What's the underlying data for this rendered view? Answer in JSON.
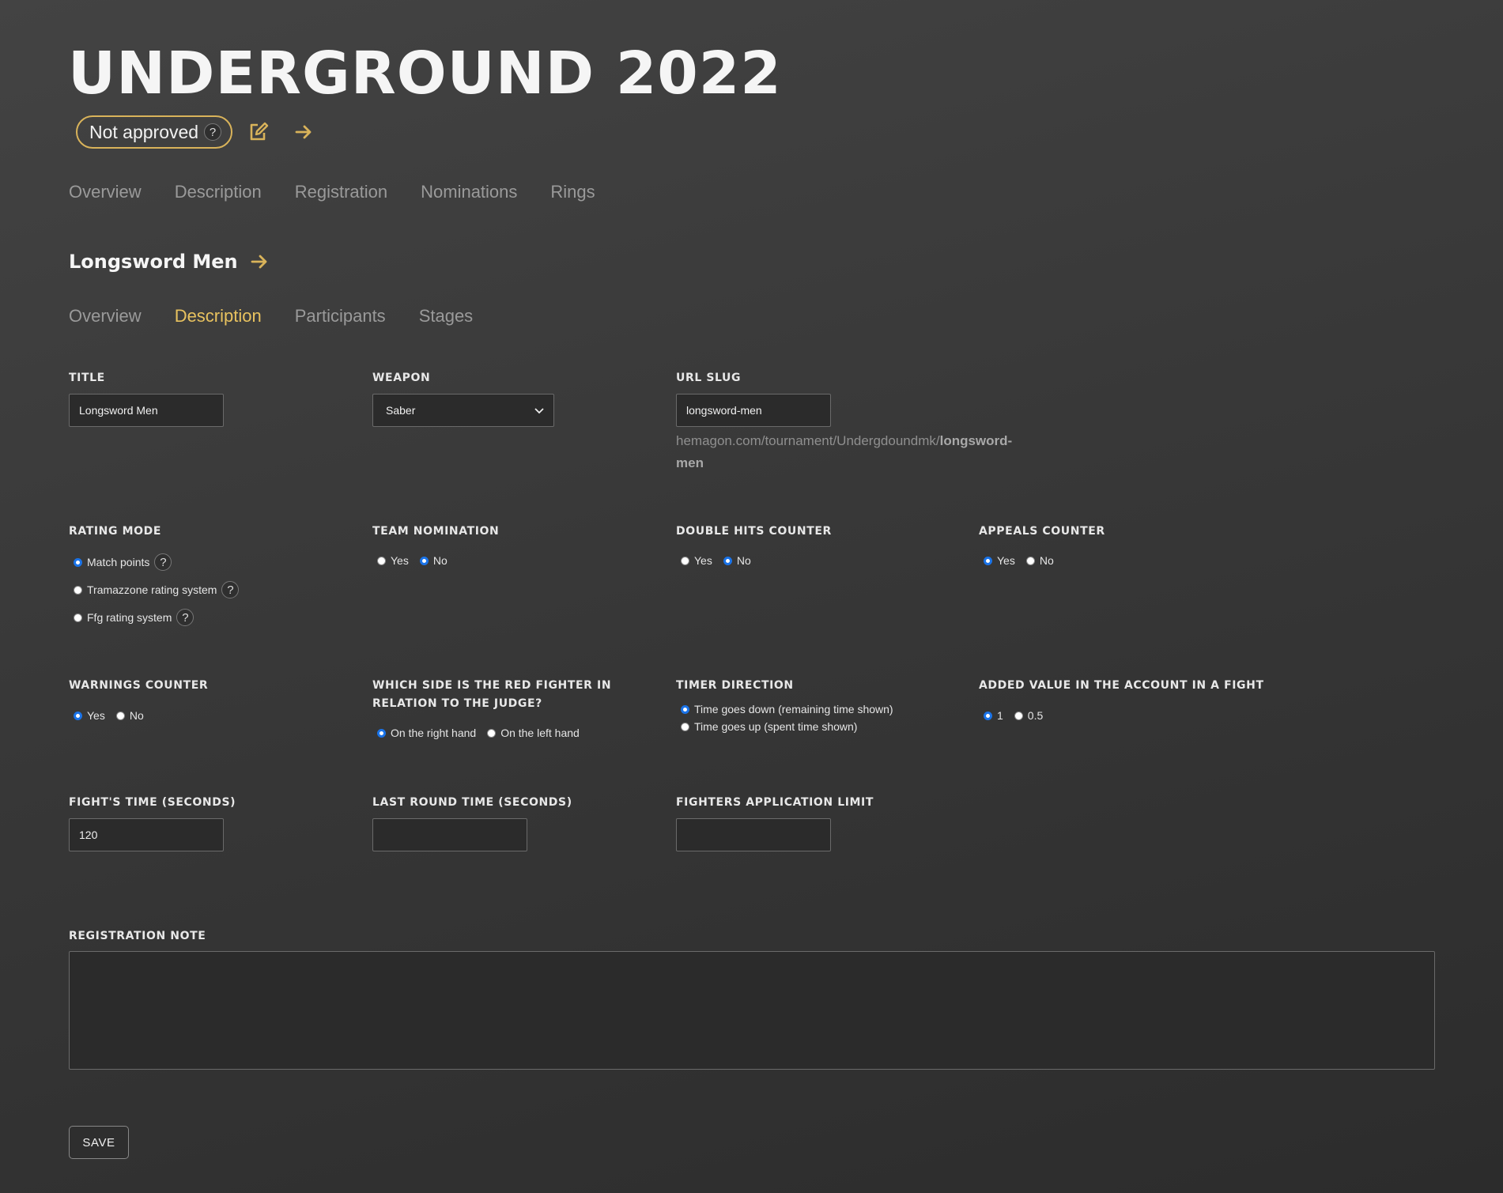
{
  "header": {
    "title": "UNDERGROUND 2022",
    "status_label": "Not approved",
    "help_glyph": "?",
    "icons": [
      "edit-icon",
      "arrow-right-icon"
    ],
    "accent_color": "#d9b35a"
  },
  "tournament_tabs": [
    "Overview",
    "Description",
    "Registration",
    "Nominations",
    "Rings"
  ],
  "nomination": {
    "title": "Longsword Men",
    "tabs": [
      "Overview",
      "Description",
      "Participants",
      "Stages"
    ],
    "active_tab": "Description"
  },
  "form": {
    "title": {
      "label": "TITLE",
      "value": "Longsword Men"
    },
    "weapon": {
      "label": "WEAPON",
      "selected": "Saber"
    },
    "url_slug": {
      "label": "URL SLUG",
      "value": "longsword-men",
      "preview_prefix": "hemagon.com/tournament/Undergdoundmk/",
      "preview_slug": "longsword-men"
    },
    "rating_mode": {
      "label": "RATING MODE",
      "options": [
        "Match points",
        "Tramazzone rating system",
        "Ffg rating system"
      ],
      "selected": "Match points"
    },
    "team_nomination": {
      "label": "TEAM NOMINATION",
      "options": [
        "Yes",
        "No"
      ],
      "selected": "No"
    },
    "double_hits_counter": {
      "label": "DOUBLE HITS COUNTER",
      "options": [
        "Yes",
        "No"
      ],
      "selected": "No"
    },
    "appeals_counter": {
      "label": "APPEALS COUNTER",
      "options": [
        "Yes",
        "No"
      ],
      "selected": "Yes"
    },
    "warnings_counter": {
      "label": "WARNINGS COUNTER",
      "options": [
        "Yes",
        "No"
      ],
      "selected": "Yes"
    },
    "red_fighter_side": {
      "label": "WHICH SIDE IS THE RED FIGHTER IN RELATION TO THE JUDGE?",
      "options": [
        "On the right hand",
        "On the left hand"
      ],
      "selected": "On the right hand"
    },
    "timer_direction": {
      "label": "TIMER DIRECTION",
      "options": [
        "Time goes down (remaining time shown)",
        "Time goes up (spent time shown)"
      ],
      "selected": "Time goes down (remaining time shown)"
    },
    "added_value": {
      "label": "ADDED VALUE IN THE ACCOUNT IN A FIGHT",
      "options": [
        "1",
        "0.5"
      ],
      "selected": "1"
    },
    "fights_time": {
      "label": "FIGHT'S TIME (SECONDS)",
      "value": "120"
    },
    "last_round_time": {
      "label": "LAST ROUND TIME (SECONDS)",
      "value": ""
    },
    "fighters_limit": {
      "label": "FIGHTERS APPLICATION LIMIT",
      "value": ""
    },
    "registration_note": {
      "label": "REGISTRATION NOTE",
      "value": ""
    },
    "save_label": "SAVE"
  }
}
